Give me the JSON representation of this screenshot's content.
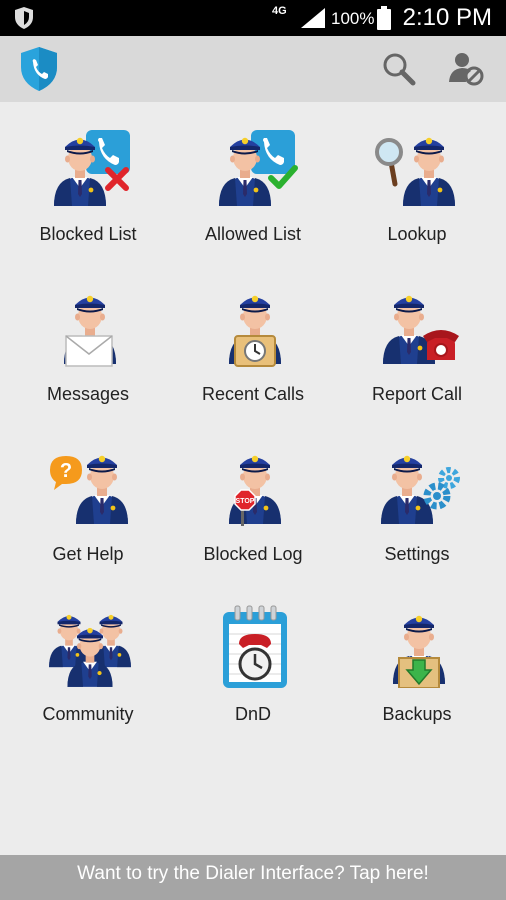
{
  "status_bar": {
    "network": "4G",
    "battery": "100%",
    "time": "2:10 PM"
  },
  "app_bar": {
    "logo_icon": "shield-phone-icon",
    "actions": [
      "search-icon",
      "user-block-icon"
    ]
  },
  "menu": [
    {
      "label": "Blocked List",
      "icon": "officer-phone-blocked"
    },
    {
      "label": "Allowed List",
      "icon": "officer-phone-allowed"
    },
    {
      "label": "Lookup",
      "icon": "officer-magnifier"
    },
    {
      "label": "Messages",
      "icon": "officer-envelope"
    },
    {
      "label": "Recent Calls",
      "icon": "officer-clock"
    },
    {
      "label": "Report Call",
      "icon": "officer-red-phone"
    },
    {
      "label": "Get Help",
      "icon": "officer-question"
    },
    {
      "label": "Blocked Log",
      "icon": "officer-stop-sign"
    },
    {
      "label": "Settings",
      "icon": "officer-gears"
    },
    {
      "label": "Community",
      "icon": "officer-group"
    },
    {
      "label": "DnD",
      "icon": "calendar-clock"
    },
    {
      "label": "Backups",
      "icon": "officer-box-download"
    }
  ],
  "bottom_bar": {
    "text": "Want to try the Dialer Interface? Tap here!"
  },
  "colors": {
    "status_bar": "#000000",
    "app_bar": "#d9d9d9",
    "background": "#ececec",
    "bottom_bar": "#a5a5a5",
    "brand_blue": "#29a3dc"
  }
}
